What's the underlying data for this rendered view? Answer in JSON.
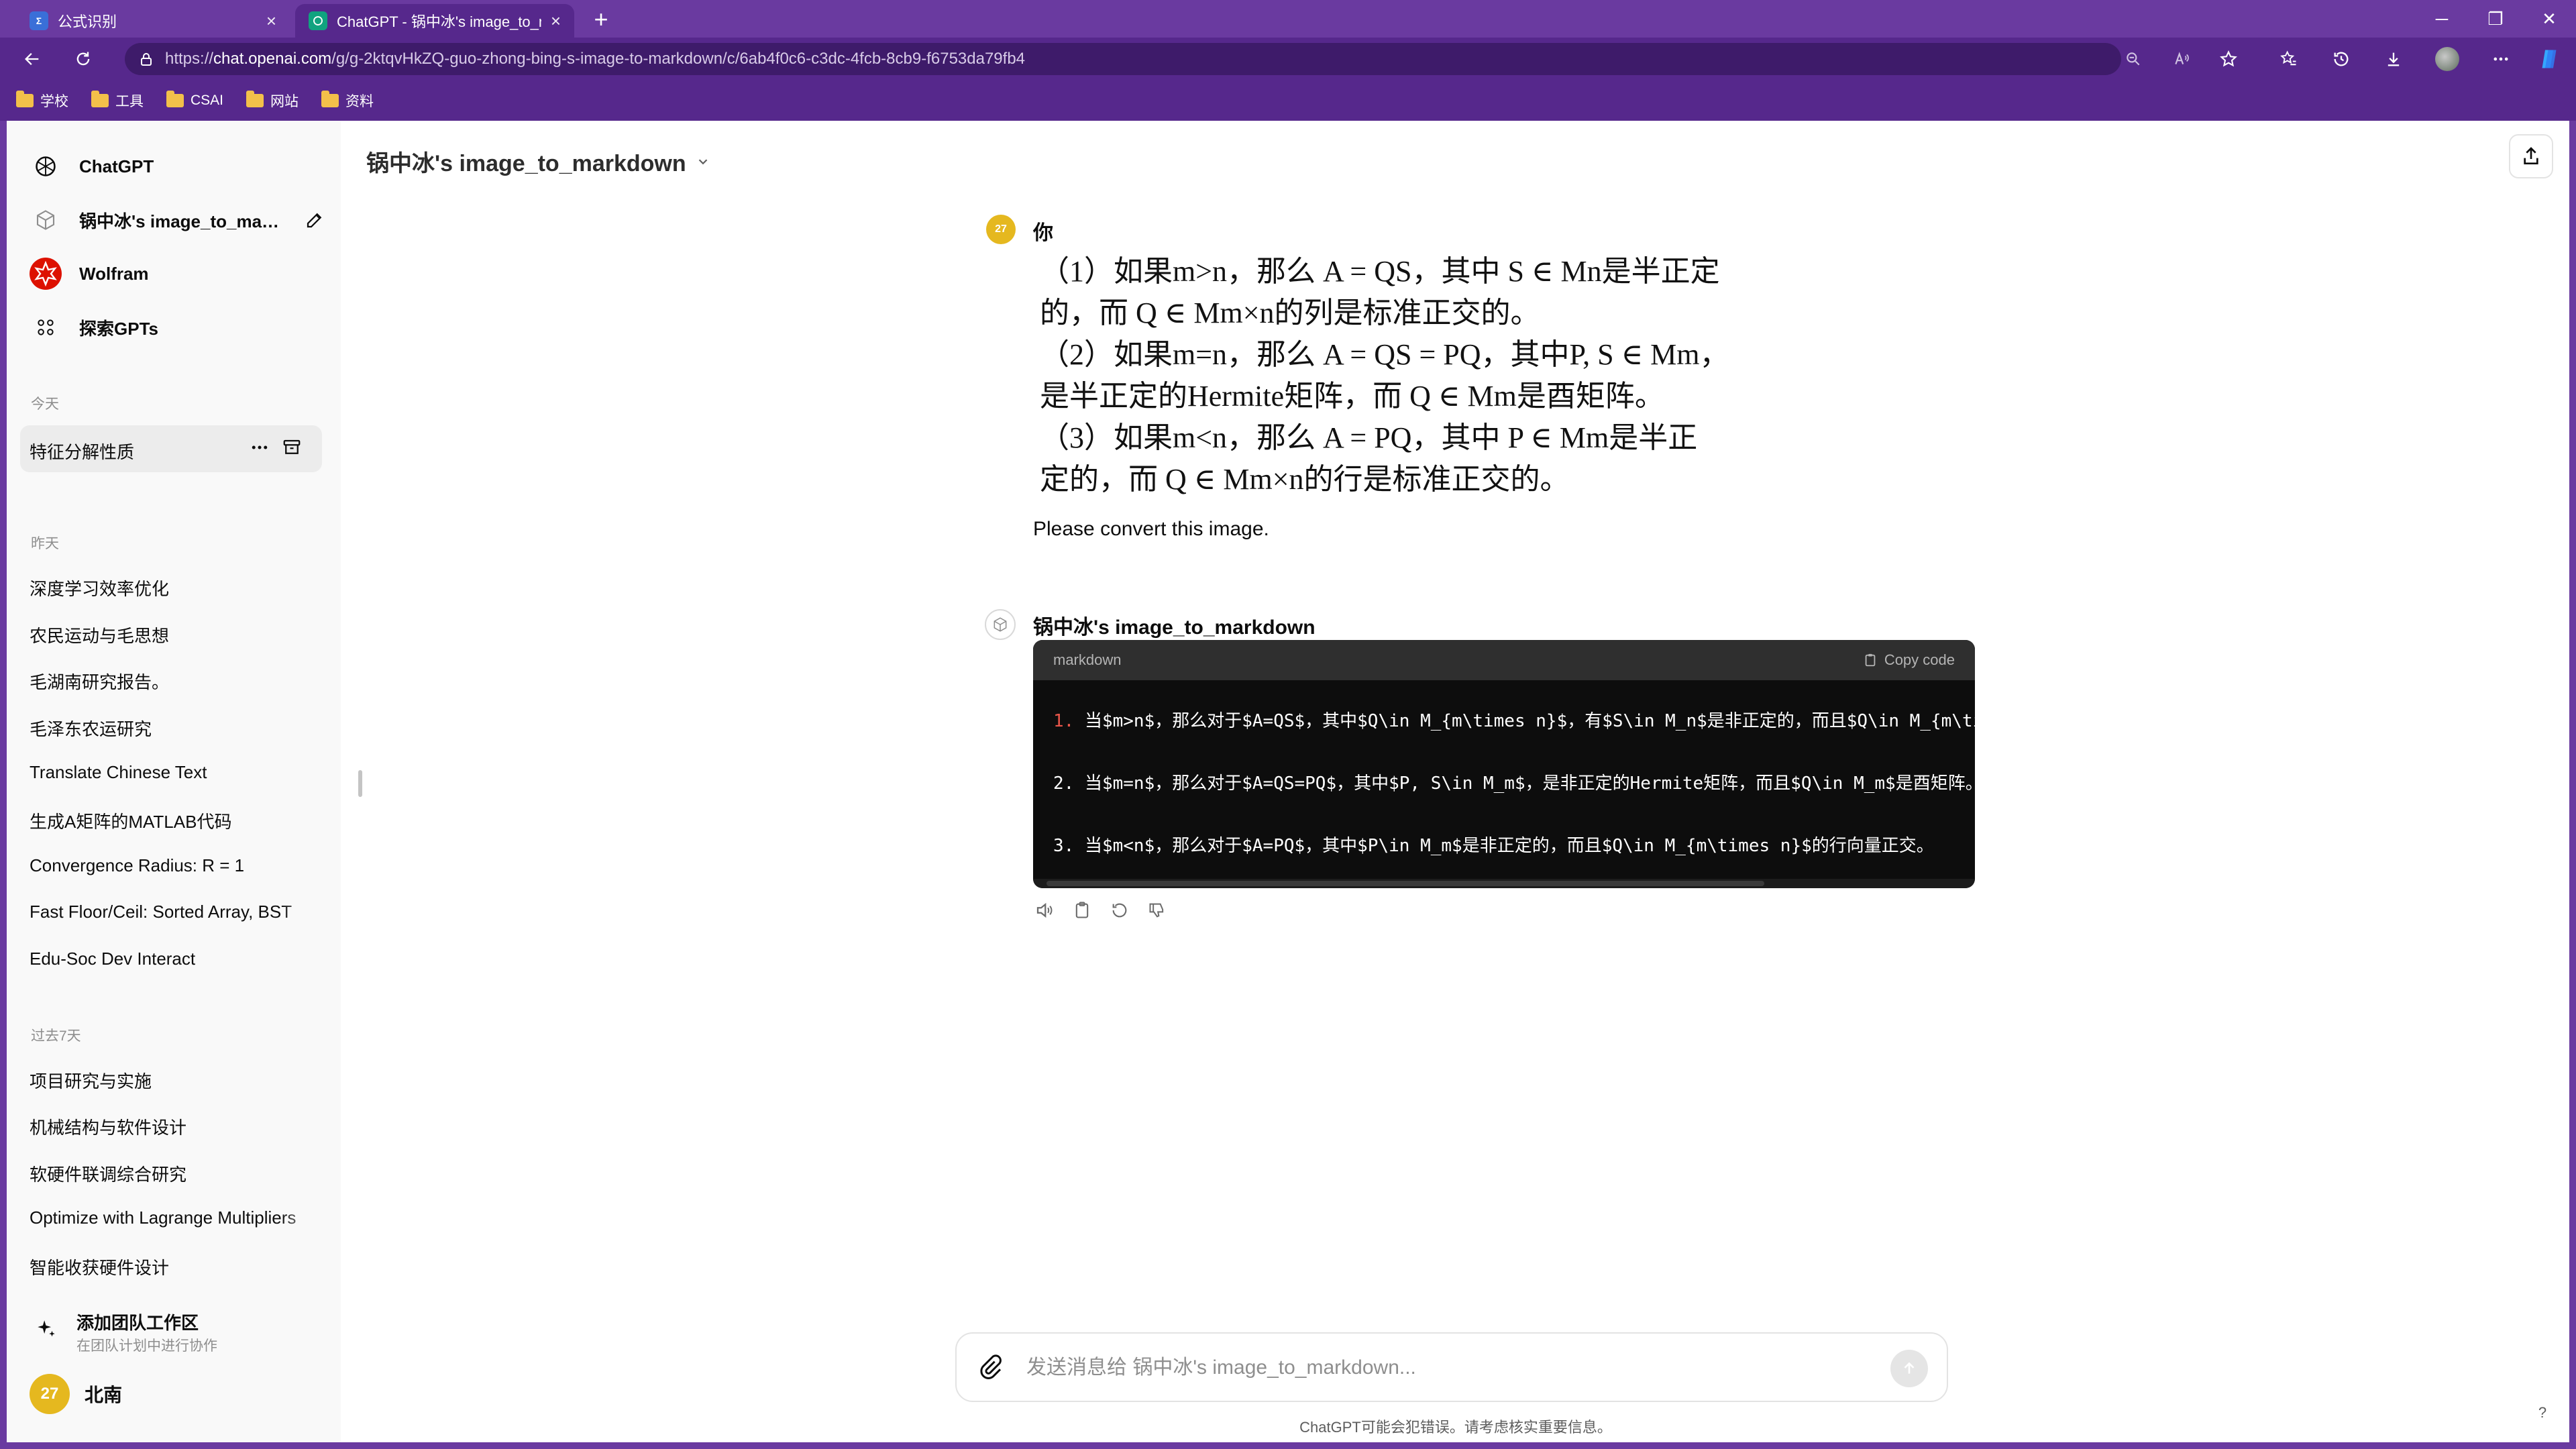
{
  "browser": {
    "tabs": [
      {
        "title": "公式识别",
        "icon": "formula-favicon",
        "color": "#3a6fd8"
      },
      {
        "title": "ChatGPT - 锅中冰's image_to_ma",
        "icon": "chatgpt-favicon",
        "color": "#10a37f"
      }
    ],
    "new_tab": "+",
    "window": {
      "minimize": "─",
      "restore": "❐",
      "close": "✕"
    },
    "url": {
      "prefix": "https://",
      "domain": "chat.openai.com",
      "path": "/g/g-2ktqvHkZQ-guo-zhong-bing-s-image-to-markdown/c/6ab4f0c6-c3dc-4fcb-8cb9-f6753da79fb4"
    },
    "bookmarks": [
      "学校",
      "工具",
      "CSAI",
      "网站",
      "资料"
    ]
  },
  "sidebar": {
    "top_items": [
      {
        "label": "ChatGPT",
        "icon": "openai-logo-icon"
      },
      {
        "label": "锅中冰's image_to_ma…",
        "icon": "gpt-cube-icon"
      },
      {
        "label": "Wolfram",
        "icon": "wolfram-logo-icon"
      },
      {
        "label": "探索GPTs",
        "icon": "grid-icon"
      }
    ],
    "sections": [
      {
        "title": "今天",
        "items": [
          "特征分解性质"
        ]
      },
      {
        "title": "昨天",
        "items": [
          "深度学习效率优化",
          "农民运动与毛思想",
          "毛湖南研究报告。",
          "毛泽东农运研究",
          "Translate Chinese Text",
          "生成A矩阵的MATLAB代码",
          "Convergence Radius: R = 1",
          "Fast Floor/Ceil: Sorted Array, BST",
          "Edu-Soc Dev Interact"
        ]
      },
      {
        "title": "过去7天",
        "items": [
          "项目研究与实施",
          "机械结构与软件设计",
          "软硬件联调综合研究",
          "Optimize with Lagrange Multipliers",
          "智能收获硬件设计"
        ]
      }
    ],
    "team": {
      "title": "添加团队工作区",
      "subtitle": "在团队计划中进行协作"
    },
    "user": {
      "avatar_text": "27",
      "name": "北南",
      "avatar_color": "#e5b81f"
    }
  },
  "header": {
    "title": "锅中冰's image_to_markdown"
  },
  "messages": {
    "user_label": "你",
    "user_avatar_text": "27",
    "image_lines": [
      "（1）如果m>n，那么 A = QS，其中 S ∈ Mn是半正定",
      "的，而 Q ∈ Mm×n的列是标准正交的。",
      "（2）如果m=n，那么 A = QS = PQ，其中P, S ∈ Mm，",
      "是半正定的Hermite矩阵，而 Q ∈ Mm是酉矩阵。",
      "（3）如果m<n，那么 A = PQ，其中 P ∈ Mm是半正",
      "定的，而 Q ∈ Mm×n的行是标准正交的。"
    ],
    "user_text": "Please convert this image.",
    "bot_label": "锅中冰's image_to_markdown",
    "code_lang": "markdown",
    "copy_label": "Copy code",
    "code_lines": [
      {
        "num": "1.",
        "text": "当$m>n$，那么对于$A=QS$，其中$Q\\in M_{m\\times n}$，有$S\\in M_n$是非正定的，而且$Q\\in M_{m\\times n}$的列向量正交。"
      },
      {
        "num": "2.",
        "text": "当$m=n$，那么对于$A=QS=PQ$，其中$P, S\\in M_m$，是非正定的Hermite矩阵，而且$Q\\in M_m$是酉矩阵。"
      },
      {
        "num": "3.",
        "text": "当$m<n$，那么对于$A=PQ$，其中$P\\in M_m$是非正定的，而且$Q\\in M_{m\\times n}$的行向量正交。"
      }
    ]
  },
  "composer": {
    "placeholder": "发送消息给 锅中冰's image_to_markdown..."
  },
  "footer": {
    "disclaimer": "ChatGPT可能会犯错误。请考虑核实重要信息。",
    "help": "?"
  }
}
